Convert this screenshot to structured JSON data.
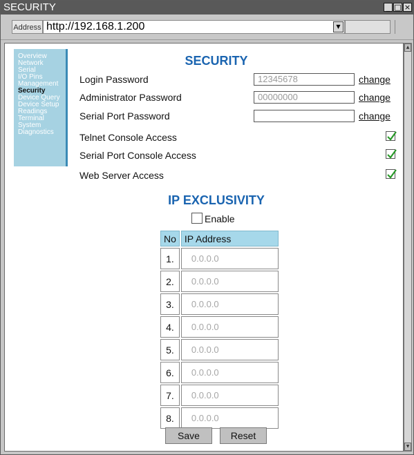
{
  "window": {
    "title": "SECURITY",
    "controls": [
      "_",
      "□",
      "×"
    ]
  },
  "address": {
    "label": "Address",
    "url": "http://192.168.1.200"
  },
  "sidebar": {
    "items": [
      {
        "label": "Overview",
        "active": false
      },
      {
        "label": "Network",
        "active": false
      },
      {
        "label": "Serial",
        "active": false
      },
      {
        "label": "I/O Pins",
        "active": false
      },
      {
        "label": "Management",
        "active": false
      },
      {
        "label": "Security",
        "active": true
      },
      {
        "label": "Device Query",
        "active": false
      },
      {
        "label": "Device Setup",
        "active": false
      },
      {
        "label": "Readings",
        "active": false
      },
      {
        "label": "Terminal",
        "active": false
      },
      {
        "label": "System",
        "active": false
      },
      {
        "label": "Diagnostics",
        "active": false
      }
    ]
  },
  "security": {
    "title": "SECURITY",
    "login_password": {
      "label": "Login Password",
      "value": "12345678",
      "change": "change"
    },
    "admin_password": {
      "label": "Administrator Password",
      "value": "00000000",
      "change": "change"
    },
    "serial_password": {
      "label": "Serial Port Password",
      "value": "",
      "change": "change"
    },
    "telnet_access": {
      "label": "Telnet Console  Access",
      "checked": true
    },
    "serial_console_access": {
      "label": "Serial Port Console Access",
      "checked": true
    },
    "web_access": {
      "label": "Web Server Access",
      "checked": true
    }
  },
  "ip_exclusivity": {
    "title": "IP EXCLUSIVITY",
    "enable_label": "Enable",
    "enabled": false,
    "headers": {
      "no": "No",
      "ip": "IP Address"
    },
    "rows": [
      {
        "no": "1.",
        "ip": "0.0.0.0"
      },
      {
        "no": "2.",
        "ip": "0.0.0.0"
      },
      {
        "no": "3.",
        "ip": "0.0.0.0"
      },
      {
        "no": "4.",
        "ip": "0.0.0.0"
      },
      {
        "no": "5.",
        "ip": "0.0.0.0"
      },
      {
        "no": "6.",
        "ip": "0.0.0.0"
      },
      {
        "no": "7.",
        "ip": "0.0.0.0"
      },
      {
        "no": "8.",
        "ip": "0.0.0.0"
      }
    ]
  },
  "buttons": {
    "save": "Save",
    "reset": "Reset"
  },
  "colors": {
    "accent": "#1a64b0",
    "sidebar_bg": "#a6d2e2",
    "sidebar_border": "#3a8ab6",
    "check": "#2a9a2a"
  }
}
